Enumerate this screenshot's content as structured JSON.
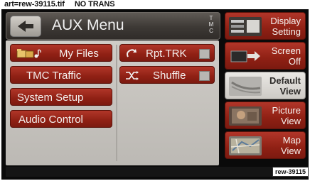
{
  "caption": {
    "left": "art=rew-39115.tif",
    "right": "NO TRANS"
  },
  "header": {
    "title": "AUX Menu",
    "tmc_label": "T M C"
  },
  "menu": {
    "left": [
      {
        "label": "My Files"
      },
      {
        "label": "TMC Traffic"
      },
      {
        "label": "System Setup"
      },
      {
        "label": "Audio Control"
      }
    ],
    "right": [
      {
        "label": "Rpt.TRK",
        "checked": false
      },
      {
        "label": "Shuffle",
        "checked": false
      }
    ]
  },
  "side": [
    {
      "line1": "Display",
      "line2": "Setting",
      "active": false
    },
    {
      "line1": "Screen",
      "line2": "Off",
      "active": false
    },
    {
      "line1": "Default",
      "line2": "View",
      "active": true
    },
    {
      "line1": "Picture",
      "line2": "View",
      "active": false
    },
    {
      "line1": "Map",
      "line2": "View",
      "active": false
    }
  ],
  "reference": "rew-39115",
  "colors": {
    "button_red": "#9a2417",
    "panel_gray": "#c8c5c0",
    "active_gray": "#dcd9d4"
  }
}
